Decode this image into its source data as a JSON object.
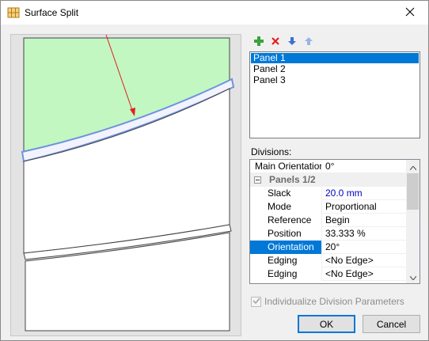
{
  "window": {
    "title": "Surface Split",
    "title_icon": "grid-panel-icon",
    "close_icon": "close-icon"
  },
  "toolbar": {
    "buttons": [
      {
        "icon": "add-icon",
        "color": "#3aa33a"
      },
      {
        "icon": "delete-icon",
        "color": "#e02020"
      },
      {
        "icon": "move-down-icon",
        "color": "#3c6fd6"
      },
      {
        "icon": "move-up-icon",
        "color": "#9ab4e8"
      }
    ]
  },
  "panels": {
    "items": [
      "Panel 1",
      "Panel 2",
      "Panel 3"
    ],
    "selected": "Panel 1"
  },
  "divisions": {
    "label": "Divisions:",
    "rows": [
      {
        "name": "Main Orientation",
        "value": "0°"
      },
      {
        "category": "Panels 1/2"
      },
      {
        "name": "Slack",
        "value": "20.0 mm"
      },
      {
        "name": "Mode",
        "value": "Proportional"
      },
      {
        "name": "Reference",
        "value": "Begin"
      },
      {
        "name": "Position",
        "value": "33.333 %"
      },
      {
        "name": "Orientation",
        "value": "20°"
      },
      {
        "name": "Edging",
        "value": "<No Edge>"
      },
      {
        "name": "Edging",
        "value": "<No Edge>"
      }
    ],
    "selected_row": "Orientation"
  },
  "individualize": {
    "label": "Individualize Division Parameters",
    "checked": true,
    "enabled": false
  },
  "buttons": {
    "ok": "OK",
    "cancel": "Cancel"
  },
  "colors": {
    "accent": "#0078d7",
    "panel_fill": "#c2f7c2",
    "split_outline": "#6e93de",
    "direction_arrow": "#e02020",
    "blue_value": "#0000c8"
  }
}
